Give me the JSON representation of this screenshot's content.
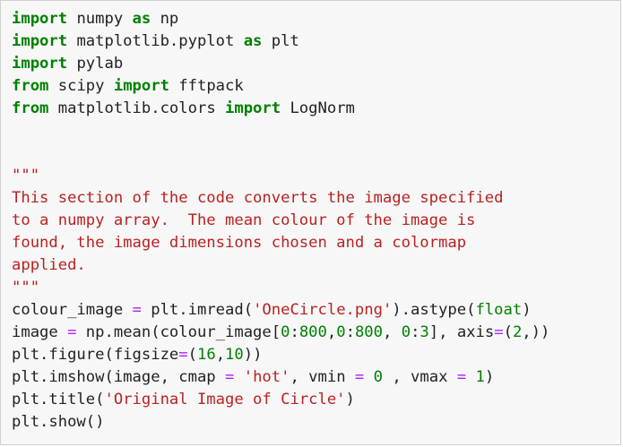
{
  "cell": {
    "lines": [
      [
        {
          "t": "import",
          "c": "kw"
        },
        {
          "t": " numpy ",
          "c": ""
        },
        {
          "t": "as",
          "c": "kw"
        },
        {
          "t": " np",
          "c": ""
        }
      ],
      [
        {
          "t": "import",
          "c": "kw"
        },
        {
          "t": " matplotlib.pyplot ",
          "c": ""
        },
        {
          "t": "as",
          "c": "kw"
        },
        {
          "t": " plt",
          "c": ""
        }
      ],
      [
        {
          "t": "import",
          "c": "kw"
        },
        {
          "t": " pylab",
          "c": ""
        }
      ],
      [
        {
          "t": "from",
          "c": "kw"
        },
        {
          "t": " scipy ",
          "c": ""
        },
        {
          "t": "import",
          "c": "kw"
        },
        {
          "t": " fftpack",
          "c": ""
        }
      ],
      [
        {
          "t": "from",
          "c": "kw"
        },
        {
          "t": " matplotlib.colors ",
          "c": ""
        },
        {
          "t": "import",
          "c": "kw"
        },
        {
          "t": " LogNorm",
          "c": ""
        }
      ],
      [],
      [],
      [
        {
          "t": "\"\"\"",
          "c": "doc"
        }
      ],
      [
        {
          "t": "This section of the code converts the image specified",
          "c": "doc"
        }
      ],
      [
        {
          "t": "to a numpy array.  The mean colour of the image is",
          "c": "doc"
        }
      ],
      [
        {
          "t": "found, the image dimensions chosen and a colormap",
          "c": "doc"
        }
      ],
      [
        {
          "t": "applied.",
          "c": "doc"
        }
      ],
      [
        {
          "t": "\"\"\"",
          "c": "doc"
        }
      ],
      [
        {
          "t": "colour_image ",
          "c": ""
        },
        {
          "t": "=",
          "c": "op"
        },
        {
          "t": " plt.imread(",
          "c": ""
        },
        {
          "t": "'OneCircle.png'",
          "c": "str"
        },
        {
          "t": ").astype(",
          "c": ""
        },
        {
          "t": "float",
          "c": "num"
        },
        {
          "t": ")",
          "c": ""
        }
      ],
      [
        {
          "t": "image ",
          "c": ""
        },
        {
          "t": "=",
          "c": "op"
        },
        {
          "t": " np.mean(colour_image[",
          "c": ""
        },
        {
          "t": "0",
          "c": "num"
        },
        {
          "t": ":",
          "c": ""
        },
        {
          "t": "800",
          "c": "num"
        },
        {
          "t": ",",
          "c": ""
        },
        {
          "t": "0",
          "c": "num"
        },
        {
          "t": ":",
          "c": ""
        },
        {
          "t": "800",
          "c": "num"
        },
        {
          "t": ", ",
          "c": ""
        },
        {
          "t": "0",
          "c": "num"
        },
        {
          "t": ":",
          "c": ""
        },
        {
          "t": "3",
          "c": "num"
        },
        {
          "t": "], axis",
          "c": ""
        },
        {
          "t": "=",
          "c": "op"
        },
        {
          "t": "(",
          "c": ""
        },
        {
          "t": "2",
          "c": "num"
        },
        {
          "t": ",))",
          "c": ""
        }
      ],
      [
        {
          "t": "plt.figure(figsize",
          "c": ""
        },
        {
          "t": "=",
          "c": "op"
        },
        {
          "t": "(",
          "c": ""
        },
        {
          "t": "16",
          "c": "num"
        },
        {
          "t": ",",
          "c": ""
        },
        {
          "t": "10",
          "c": "num"
        },
        {
          "t": "))",
          "c": ""
        }
      ],
      [
        {
          "t": "plt.imshow(image, cmap ",
          "c": ""
        },
        {
          "t": "=",
          "c": "op"
        },
        {
          "t": " ",
          "c": ""
        },
        {
          "t": "'hot'",
          "c": "str"
        },
        {
          "t": ", vmin ",
          "c": ""
        },
        {
          "t": "=",
          "c": "op"
        },
        {
          "t": " ",
          "c": ""
        },
        {
          "t": "0",
          "c": "num"
        },
        {
          "t": " , vmax ",
          "c": ""
        },
        {
          "t": "=",
          "c": "op"
        },
        {
          "t": " ",
          "c": ""
        },
        {
          "t": "1",
          "c": "num"
        },
        {
          "t": ")",
          "c": ""
        }
      ],
      [
        {
          "t": "plt.title(",
          "c": ""
        },
        {
          "t": "'Original Image of Circle'",
          "c": "str"
        },
        {
          "t": ")",
          "c": ""
        }
      ],
      [
        {
          "t": "plt.show()",
          "c": ""
        }
      ]
    ]
  }
}
